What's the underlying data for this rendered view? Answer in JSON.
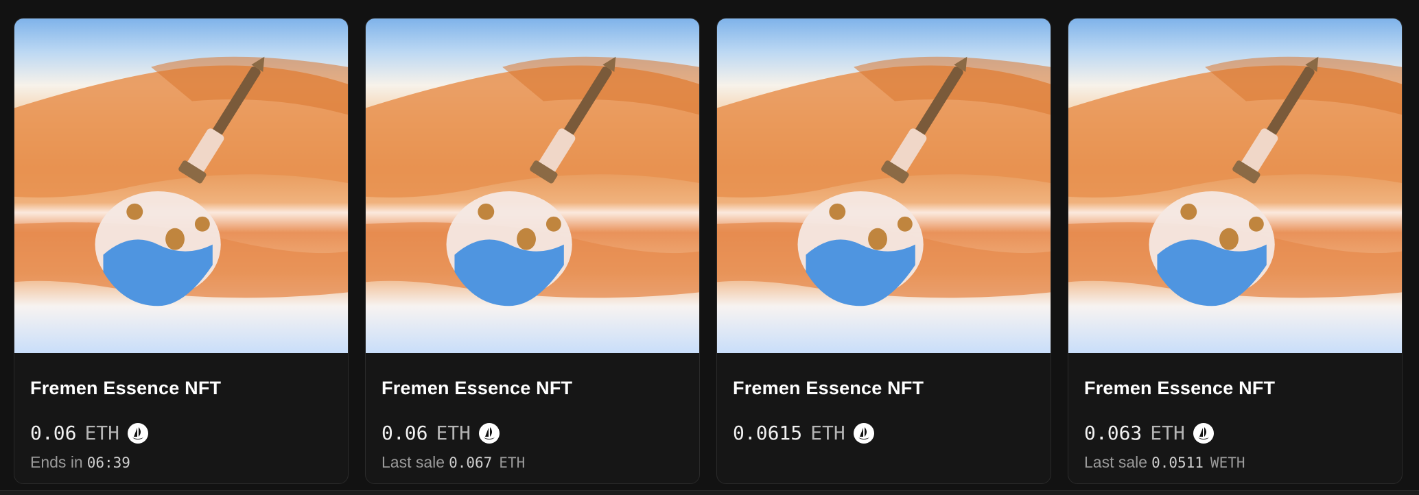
{
  "cards": [
    {
      "title": "Fremen Essence NFT",
      "price": "0.06",
      "currency": "ETH",
      "sub_label": "Ends in",
      "sub_value": "06:39",
      "sub_unit": ""
    },
    {
      "title": "Fremen Essence NFT",
      "price": "0.06",
      "currency": "ETH",
      "sub_label": "Last sale",
      "sub_value": "0.067",
      "sub_unit": "ETH"
    },
    {
      "title": "Fremen Essence NFT",
      "price": "0.0615",
      "currency": "ETH",
      "sub_label": "",
      "sub_value": "",
      "sub_unit": ""
    },
    {
      "title": "Fremen Essence NFT",
      "price": "0.063",
      "currency": "ETH",
      "sub_label": "Last sale",
      "sub_value": "0.0511",
      "sub_unit": "WETH"
    }
  ],
  "icons": {
    "marketplace": "opensea-ship-icon"
  },
  "colors": {
    "background": "#121212",
    "card": "#161616",
    "title": "#ffffff",
    "muted": "#9a9a9a"
  }
}
